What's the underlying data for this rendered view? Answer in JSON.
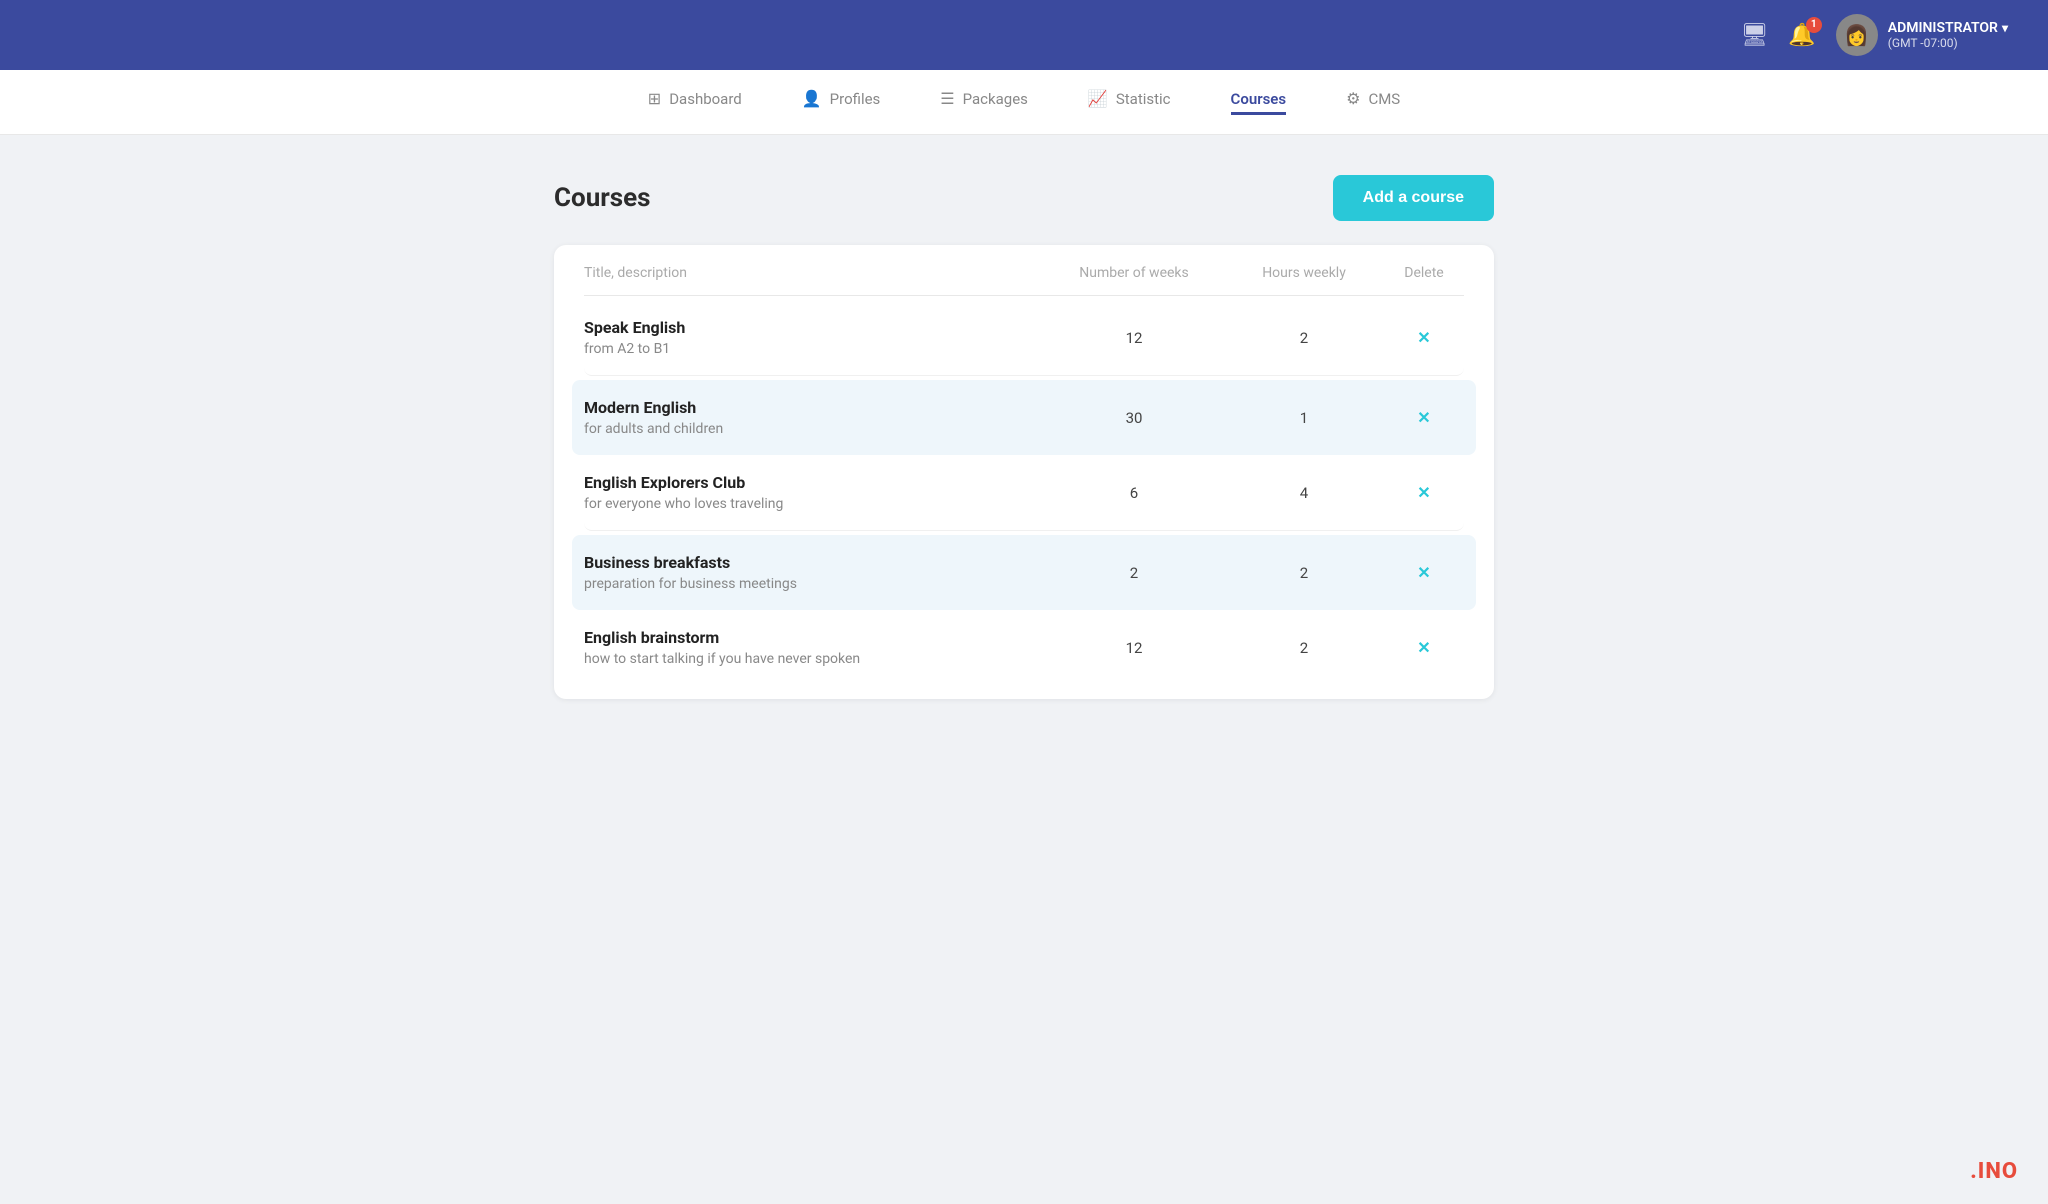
{
  "topbar": {
    "icons": [
      "monitor-icon",
      "bell-icon",
      "avatar-icon"
    ],
    "notif_count": "1",
    "user_name": "ADMINISTRATOR",
    "user_chevron": "▾",
    "user_tz": "(GMT -07:00)",
    "avatar_emoji": "👩"
  },
  "nav": {
    "items": [
      {
        "id": "dashboard",
        "label": "Dashboard",
        "icon": "⊞",
        "active": false
      },
      {
        "id": "profiles",
        "label": "Profiles",
        "icon": "👤",
        "active": false
      },
      {
        "id": "packages",
        "label": "Packages",
        "icon": "☰",
        "active": false
      },
      {
        "id": "statistic",
        "label": "Statistic",
        "icon": "📈",
        "active": false
      },
      {
        "id": "courses",
        "label": "Courses",
        "icon": "",
        "active": true
      },
      {
        "id": "cms",
        "label": "CMS",
        "icon": "⚙",
        "active": false
      }
    ]
  },
  "page": {
    "title": "Courses",
    "add_button": "Add a course"
  },
  "table": {
    "headers": {
      "title": "Title, description",
      "weeks": "Number of weeks",
      "hours": "Hours weekly",
      "delete": "Delete"
    },
    "rows": [
      {
        "title": "Speak English",
        "desc": "from A2 to B1",
        "weeks": "12",
        "hours": "2",
        "highlighted": false
      },
      {
        "title": "Modern English",
        "desc": "for adults and children",
        "weeks": "30",
        "hours": "1",
        "highlighted": true
      },
      {
        "title": "English Explorers Club",
        "desc": "for everyone who loves traveling",
        "weeks": "6",
        "hours": "4",
        "highlighted": false
      },
      {
        "title": "Business breakfasts",
        "desc": "preparation for business meetings",
        "weeks": "2",
        "hours": "2",
        "highlighted": true
      },
      {
        "title": "English brainstorm",
        "desc": "how to start talking if you have never spoken",
        "weeks": "12",
        "hours": "2",
        "highlighted": false
      }
    ]
  },
  "brand": ".INO"
}
